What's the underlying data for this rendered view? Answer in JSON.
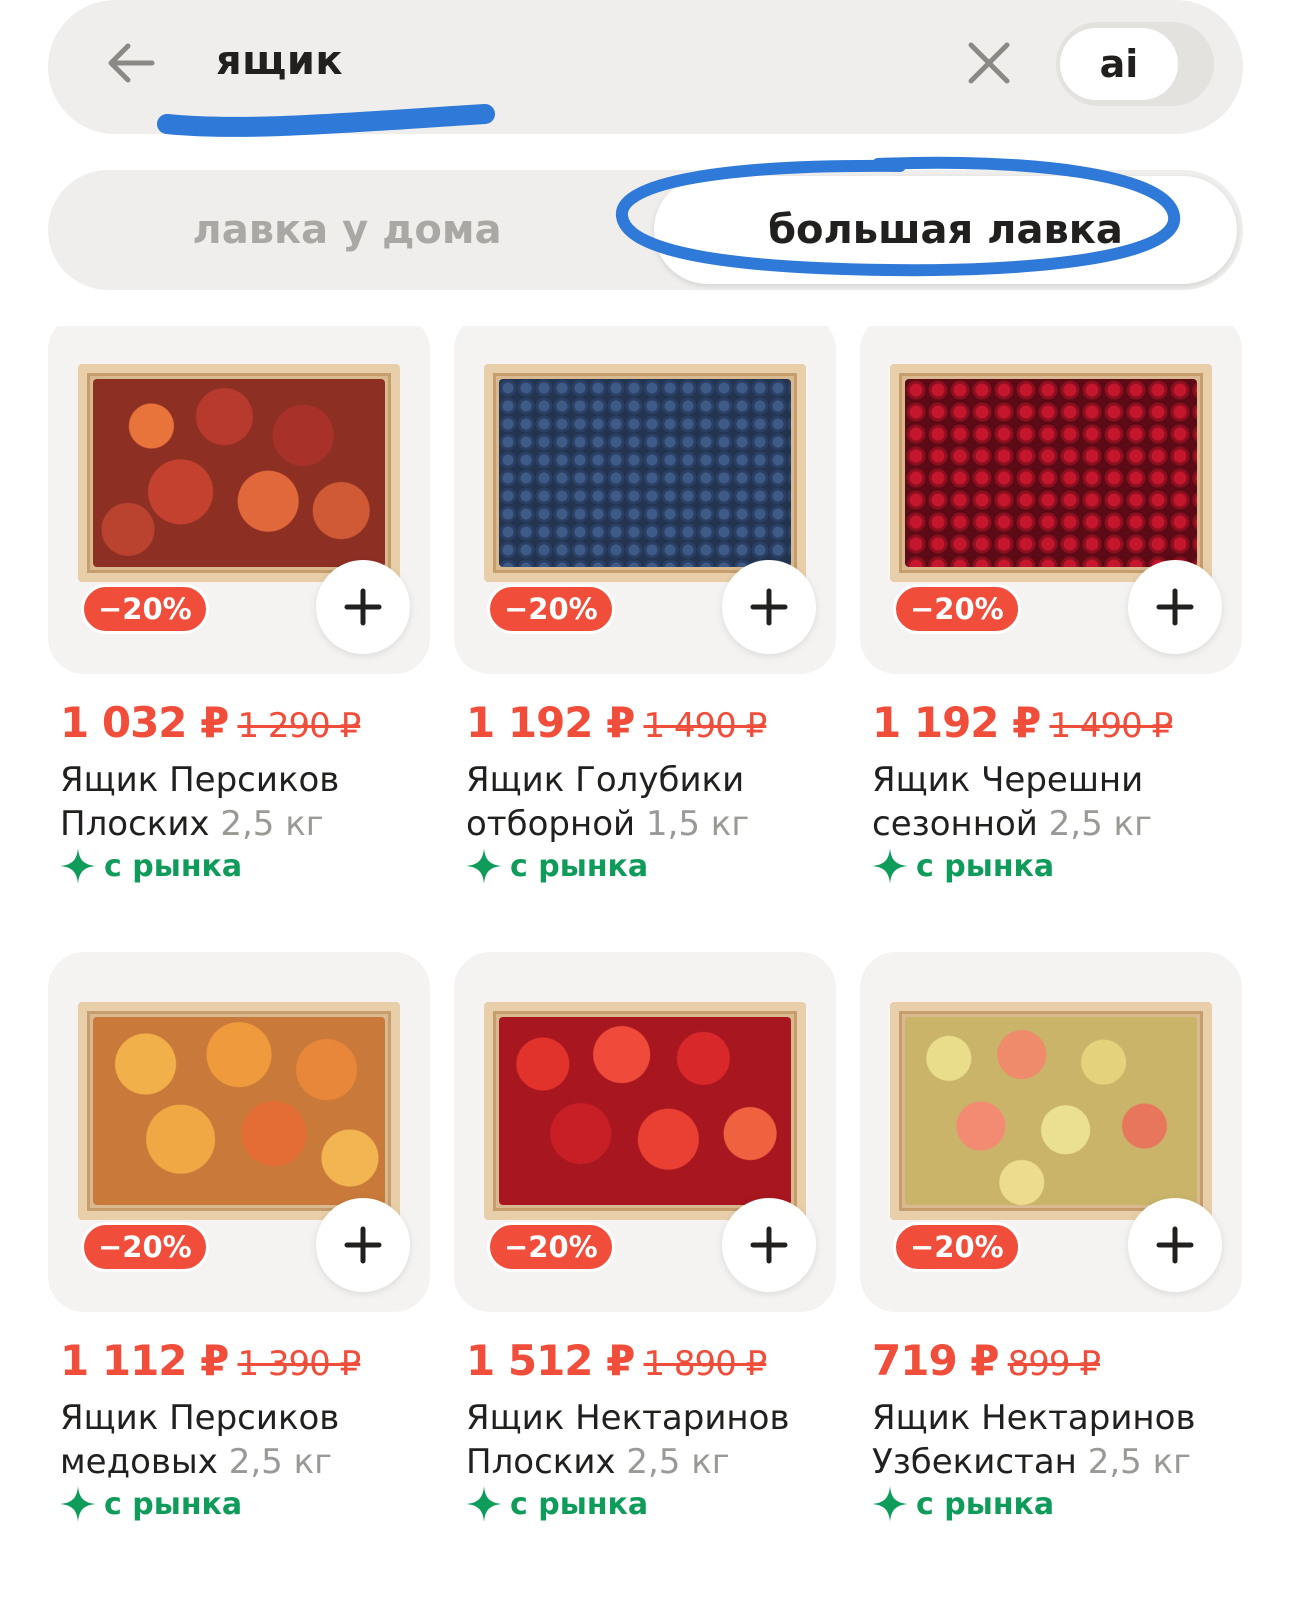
{
  "search": {
    "query": "ящик",
    "ai_label": "ai",
    "back_icon": "arrow-left-icon",
    "clear_icon": "close-icon"
  },
  "tabs": {
    "left_label": "лавка у дома",
    "right_label": "большая лавка",
    "active": "большая лавка"
  },
  "colors": {
    "accent_red": "#f04d3a",
    "market_green": "#0f9b5a",
    "annotation_blue": "#2f7ad8"
  },
  "products": [
    {
      "discount": "−20%",
      "price": "1 032 ₽",
      "old_price": "1 290 ₽",
      "name": "Ящик Персиков Плоских",
      "weight": "2,5 кг",
      "market": "с рынка"
    },
    {
      "discount": "−20%",
      "price": "1 192 ₽",
      "old_price": "1 490 ₽",
      "name": "Ящик Голубики отборной",
      "weight": "1,5 кг",
      "market": "с рынка"
    },
    {
      "discount": "−20%",
      "price": "1 192 ₽",
      "old_price": "1 490 ₽",
      "name": "Ящик Черешни сезонной",
      "weight": "2,5 кг",
      "market": "с рынка"
    },
    {
      "discount": "−20%",
      "price": "1 112 ₽",
      "old_price": "1 390 ₽",
      "name": "Ящик Персиков медовых",
      "weight": "2,5 кг",
      "market": "с рынка"
    },
    {
      "discount": "−20%",
      "price": "1 512 ₽",
      "old_price": "1 890 ₽",
      "name": "Ящик Нектаринов Плоских",
      "weight": "2,5 кг",
      "market": "с рынка"
    },
    {
      "discount": "−20%",
      "price": "719 ₽",
      "old_price": "899 ₽",
      "name": "Ящик Нектаринов Узбекистан",
      "weight": "2,5 кг",
      "market": "с рынка"
    }
  ]
}
